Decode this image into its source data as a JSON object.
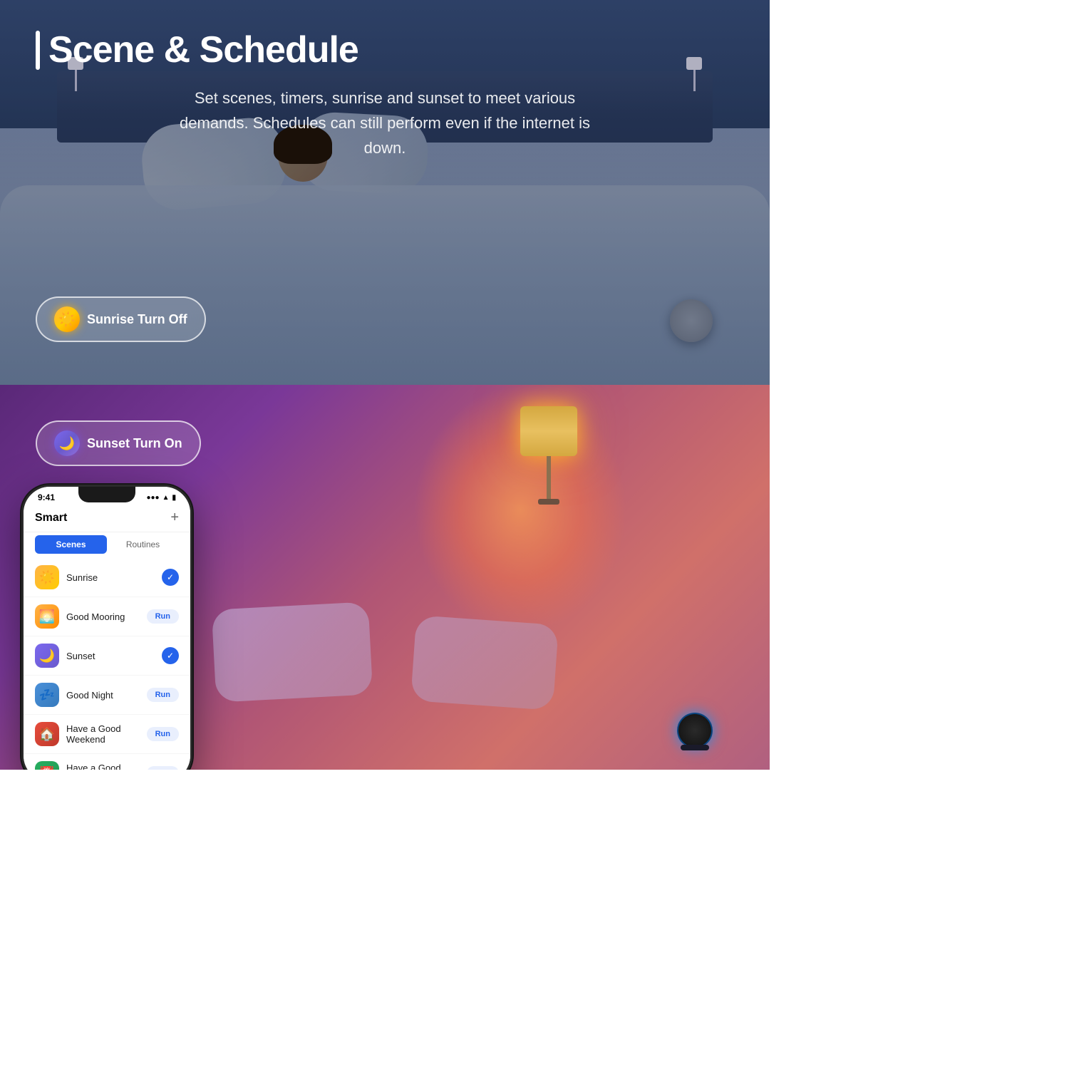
{
  "header": {
    "title_bar": "|",
    "title": "Scene & Schedule",
    "subtitle": "Set scenes, timers, sunrise and sunset to meet various demands. Schedules can still perform even if the internet is down."
  },
  "buttons": {
    "sunrise_label": "Sunrise Turn Off",
    "sunset_label": "Sunset Turn On"
  },
  "phone": {
    "status_time": "9:41",
    "status_signal": "●●●",
    "status_wifi": "WiFi",
    "status_battery": "▮▮▮",
    "header_title": "Smart",
    "header_plus": "+",
    "tab_scenes": "Scenes",
    "tab_routines": "Routines",
    "scenes": [
      {
        "icon": "☀️",
        "icon_class": "scene-icon-sunrise",
        "name": "Sunrise",
        "action": "check"
      },
      {
        "icon": "🌅",
        "icon_class": "scene-icon-morning",
        "name": "Good Mooring",
        "action": "run"
      },
      {
        "icon": "🌙",
        "icon_class": "scene-icon-sunset",
        "name": "Sunset",
        "action": "check"
      },
      {
        "icon": "💤",
        "icon_class": "scene-icon-night",
        "name": "Good Night",
        "action": "run"
      },
      {
        "icon": "🏠",
        "icon_class": "scene-icon-weekend",
        "name": "Have a Good Weekend",
        "action": "run"
      },
      {
        "icon": "📅",
        "icon_class": "scene-icon-weekend2",
        "name": "Have a Good Weekend",
        "action": "run"
      }
    ],
    "run_label": "Run",
    "check_symbol": "✓"
  }
}
